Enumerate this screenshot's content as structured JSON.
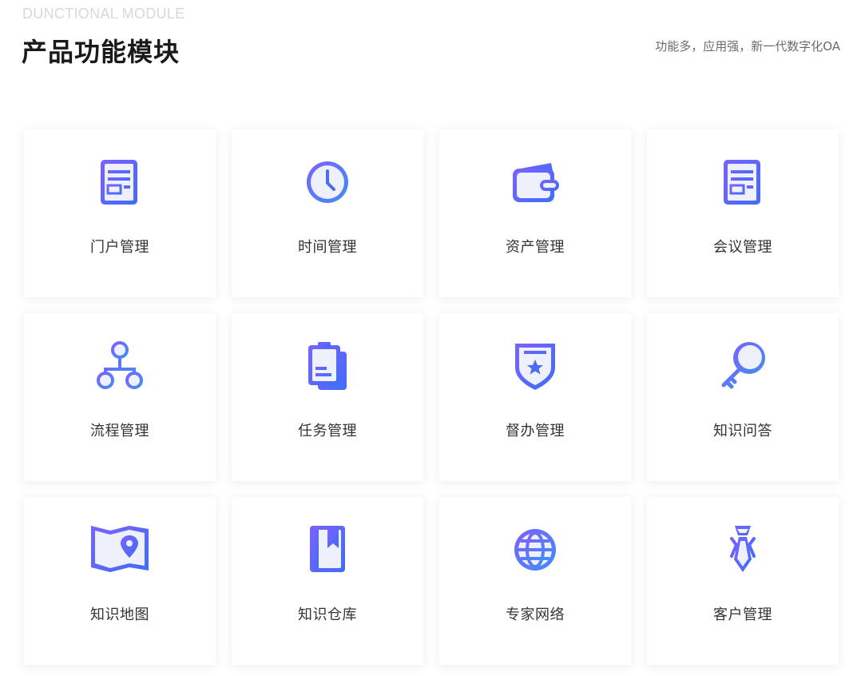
{
  "header": {
    "eyebrow": "DUNCTIONAL MODULE",
    "title": "产品功能模块",
    "subtitle": "功能多，应用强，新一代数字化OA"
  },
  "colors": {
    "icon_primary": "#4a6cf7",
    "icon_secondary": "#7b61ff",
    "icon_fill": "#eef1fb",
    "title_text": "#1a1a1a",
    "label_text": "#333333",
    "eyebrow_text": "#d8d8dc"
  },
  "modules": [
    {
      "label": "门户管理",
      "icon": "document-icon"
    },
    {
      "label": "时间管理",
      "icon": "clock-icon"
    },
    {
      "label": "资产管理",
      "icon": "wallet-icon"
    },
    {
      "label": "会议管理",
      "icon": "document-icon"
    },
    {
      "label": "流程管理",
      "icon": "flowchart-icon"
    },
    {
      "label": "任务管理",
      "icon": "clipboard-icon"
    },
    {
      "label": "督办管理",
      "icon": "shield-star-icon"
    },
    {
      "label": "知识问答",
      "icon": "key-icon"
    },
    {
      "label": "知识地图",
      "icon": "map-pin-icon"
    },
    {
      "label": "知识仓库",
      "icon": "bookmark-book-icon"
    },
    {
      "label": "专家网络",
      "icon": "globe-icon"
    },
    {
      "label": "客户管理",
      "icon": "tie-icon"
    }
  ]
}
